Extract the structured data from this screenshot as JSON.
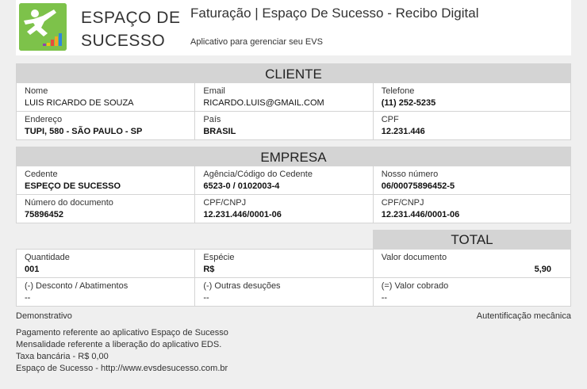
{
  "header": {
    "brand_line1": "ESPAÇO DE",
    "brand_line2": "SUCESSO",
    "title": "Faturação | Espaço De Sucesso - Recibo Digital",
    "subtitle": "Aplicativo para gerenciar seu EVS"
  },
  "cliente": {
    "heading": "CLIENTE",
    "nome_label": "Nome",
    "nome": "LUIS RICARDO DE SOUZA",
    "email_label": "Email",
    "email": "RICARDO.LUIS@GMAIL.COM",
    "telefone_label": "Telefone",
    "telefone": "(11) 252-5235",
    "endereco_label": "Endereço",
    "endereco": "TUPI, 580 - SÃO PAULO - SP",
    "pais_label": "País",
    "pais": "BRASIL",
    "cpf_label": "CPF",
    "cpf": "12.231.446"
  },
  "empresa": {
    "heading": "EMPRESA",
    "cedente_label": "Cedente",
    "cedente": "ESPEÇO DE SUCESSO",
    "agencia_label": "Agência/Código do Cedente",
    "agencia": "6523-0 / 0102003-4",
    "nosso_label": "Nosso número",
    "nosso": "06/00075896452-5",
    "numdoc_label": "Número do documento",
    "numdoc": "75896452",
    "cnpj1_label": "CPF/CNPJ",
    "cnpj1": "12.231.446/0001-06",
    "cnpj2_label": "CPF/CNPJ",
    "cnpj2": "12.231.446/0001-06"
  },
  "total": {
    "heading": "TOTAL",
    "quantidade_label": "Quantidade",
    "quantidade": "001",
    "especie_label": "Espécie",
    "especie": "R$",
    "valor_doc_label": "Valor documento",
    "valor_doc": "5,90",
    "desconto_label": "(-) Desconto / Abatimentos",
    "desconto": "--",
    "outras_label": "(-) Outras desuções",
    "outras": "--",
    "cobrado_label": "(=) Valor cobrado",
    "cobrado": "--"
  },
  "footer": {
    "demonstrativo": "Demonstrativo",
    "autenticacao": "Autentificação mecânica",
    "line1": "Pagamento referente ao aplicativo Espaço de Sucesso",
    "line2": "Mensalidade referente a liberação do aplicativo EDS.",
    "line3": "Taxa bancária - R$ 0,00",
    "line4": "Espaço de Sucesso - http://www.evsdesucesso.com.br"
  }
}
